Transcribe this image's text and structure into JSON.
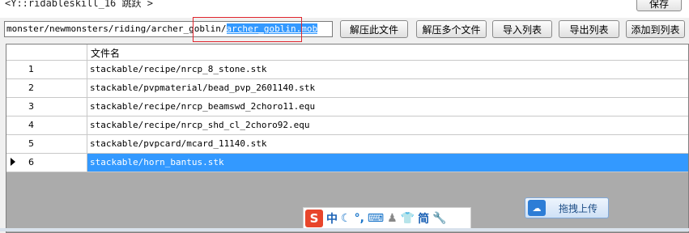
{
  "top": {
    "crumb_text": "<Y::ridableskill_16 跳跃 >",
    "save_label": "保存"
  },
  "path": {
    "prefix": "monster/newmonsters/riding/archer_goblin/",
    "selected": "archer_goblin.mob"
  },
  "toolbar": {
    "extract_this": "解压此文件",
    "extract_multi": "解压多个文件",
    "import_list": "导入列表",
    "export_list": "导出列表",
    "add_to_list": "添加到列表"
  },
  "grid": {
    "column_header": "文件名",
    "rows": [
      {
        "num": "1",
        "file": "stackable/recipe/nrcp_8_stone.stk"
      },
      {
        "num": "2",
        "file": "stackable/pvpmaterial/bead_pvp_2601140.stk"
      },
      {
        "num": "3",
        "file": "stackable/recipe/nrcp_beamswd_2choro11.equ"
      },
      {
        "num": "4",
        "file": "stackable/recipe/nrcp_shd_cl_2choro92.equ"
      },
      {
        "num": "5",
        "file": "stackable/pvpcard/mcard_11140.stk"
      },
      {
        "num": "6",
        "file": "stackable/horn_bantus.stk"
      }
    ],
    "selected_index": 5
  },
  "upload": {
    "label": "拖拽上传"
  },
  "ime": {
    "logo": "S",
    "mode": "中",
    "variant": "简"
  },
  "colors": {
    "selection": "#3399ff",
    "highlight_box": "#e0262e"
  }
}
